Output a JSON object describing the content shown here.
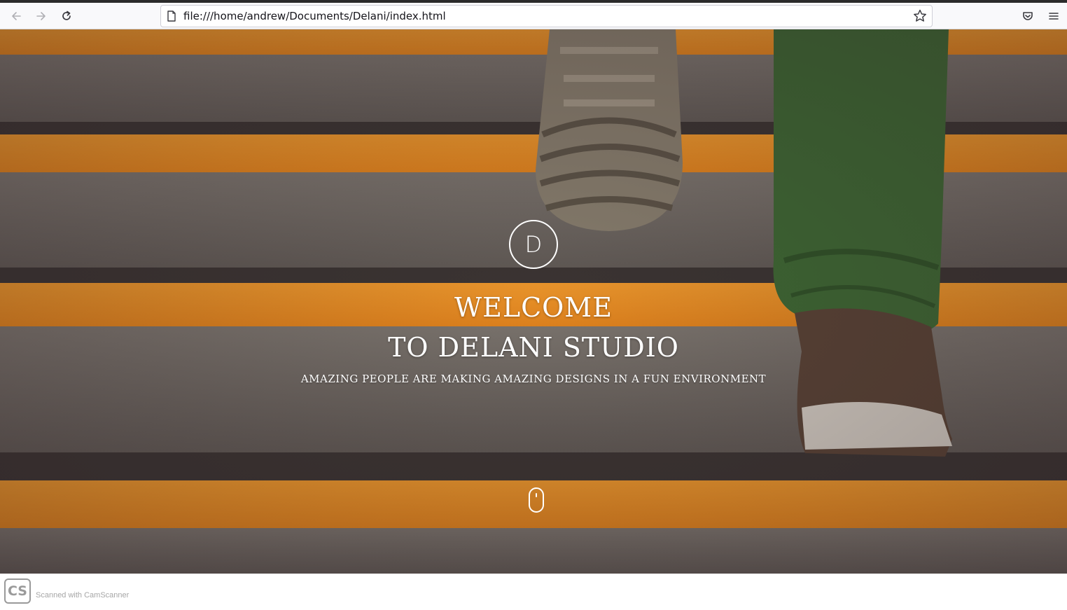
{
  "browser": {
    "url": "file:///home/andrew/Documents/Delani/index.html",
    "icons": [
      "back-icon",
      "forward-icon",
      "reload-icon",
      "page-icon",
      "bookmark-star-icon",
      "pocket-icon",
      "menu-icon"
    ]
  },
  "hero": {
    "logo_letter": "D",
    "title_line1": "WELCOME",
    "title_line2": "TO DELANI STUDIO",
    "tagline": "AMAZING PEOPLE ARE MAKING AMAZING DESIGNS IN A FUN ENVIRONMENT",
    "scroll_icon": "mouse-icon"
  },
  "watermark": {
    "logo_text": "CS",
    "text": "Scanned with CamScanner"
  },
  "colors": {
    "stair_orange": "#f39b2c",
    "stair_grey": "#6b6762",
    "text": "#ffffff"
  }
}
